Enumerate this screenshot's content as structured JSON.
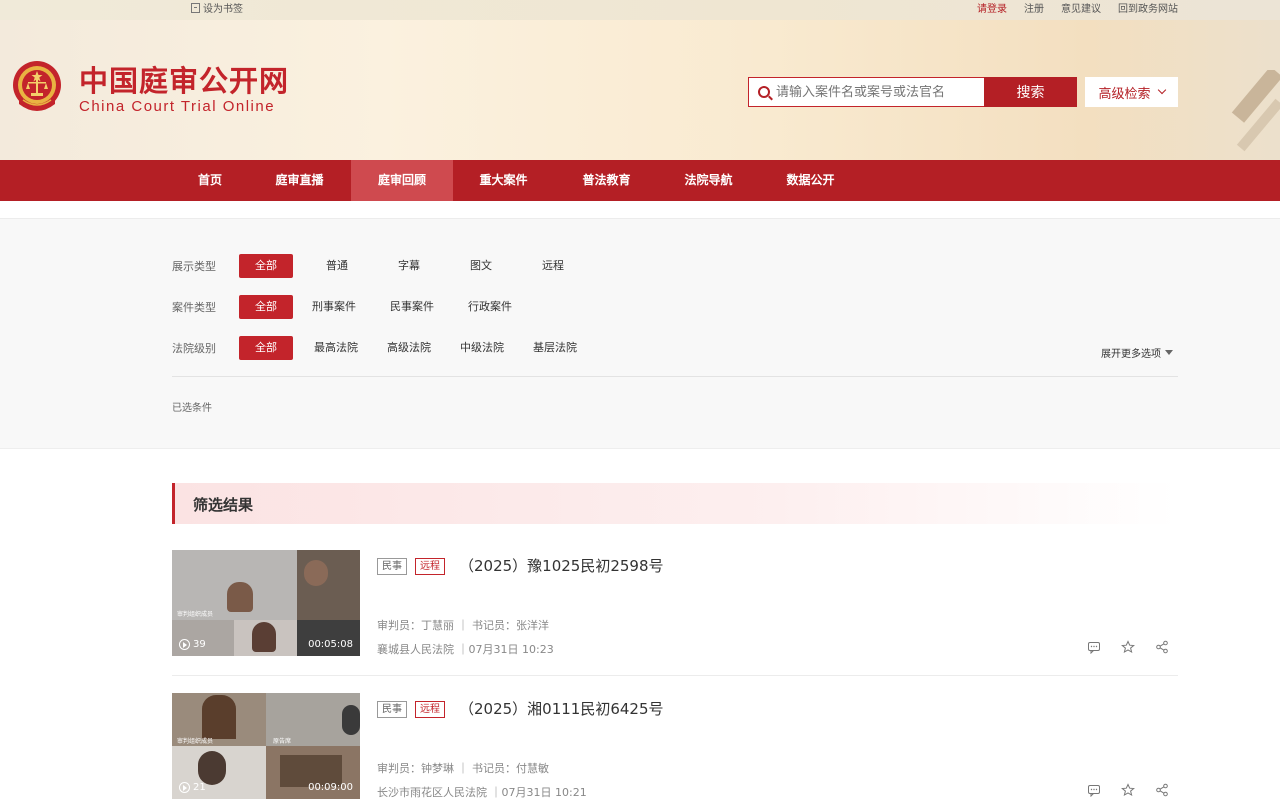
{
  "topbar": {
    "bookmark": "设为书签",
    "login": "请登录",
    "register": "注册",
    "feedback": "意见建议",
    "gov_site": "回到政务网站"
  },
  "header": {
    "logo_cn": "中国庭审公开网",
    "logo_en": "China Court Trial Online",
    "search_placeholder": "请输入案件名或案号或法官名",
    "search_button": "搜索",
    "advanced_search": "高级检索"
  },
  "nav": {
    "items": [
      "首页",
      "庭审直播",
      "庭审回顾",
      "重大案件",
      "普法教育",
      "法院导航",
      "数据公开"
    ],
    "active_index": 2
  },
  "filters": {
    "display_type": {
      "label": "展示类型",
      "options": [
        "全部",
        "普通",
        "字幕",
        "图文",
        "远程"
      ]
    },
    "case_type": {
      "label": "案件类型",
      "options": [
        "全部",
        "刑事案件",
        "民事案件",
        "行政案件"
      ]
    },
    "court_level": {
      "label": "法院级别",
      "options": [
        "全部",
        "最高法院",
        "高级法院",
        "中级法院",
        "基层法院"
      ]
    },
    "expand_more": "展开更多选项",
    "selected_conditions": "已选条件"
  },
  "results": {
    "heading": "筛选结果",
    "cases": [
      {
        "category_tag": "民事",
        "mode_tag": "远程",
        "case_number": "（2025）豫1025民初2598号",
        "judges": "审判员：丁慧丽 ｜ 书记员：张洋洋",
        "court_time": "襄城县人民法院 ｜07月31日 10:23",
        "views": "39",
        "duration": "00:05:08",
        "thumb_label": "审判组织成员"
      },
      {
        "category_tag": "民事",
        "mode_tag": "远程",
        "case_number": "（2025）湘0111民初6425号",
        "judges": "审判员：钟梦琳 ｜ 书记员：付慧敏",
        "court_time": "长沙市雨花区人民法院 ｜07月31日 10:21",
        "views": "21",
        "duration": "00:09:00",
        "thumb_label": "审判组织成员",
        "thumb_label_2": "原告席"
      }
    ]
  },
  "colors": {
    "brand_red": "#b41f25",
    "nav_active": "#cf4a4f",
    "accent": "#c3242b"
  }
}
